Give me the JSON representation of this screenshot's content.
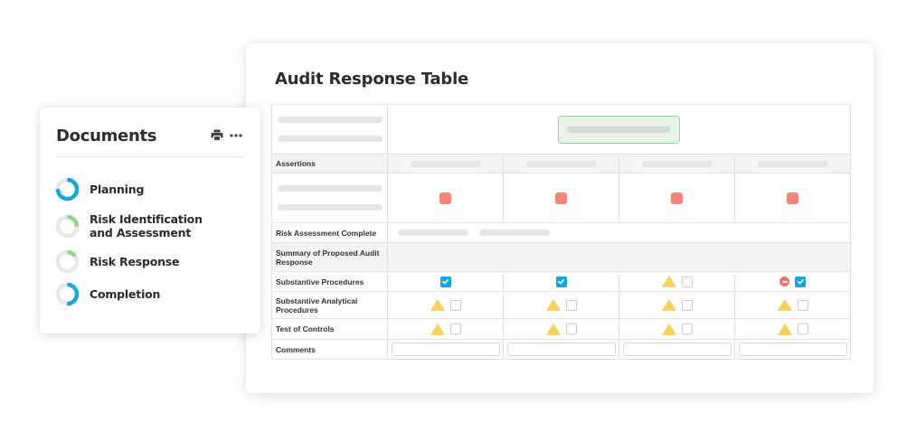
{
  "audit": {
    "title": "Audit Response Table",
    "rows": {
      "assertions": "Assertions",
      "risk_assessment": "Risk Assessment Complete",
      "summary": "Summary of Proposed Audit Response",
      "substantive": "Substantive Procedures",
      "analytical": "Substantive Analytical Procedures",
      "controls": "Test of Controls",
      "comments": "Comments"
    },
    "substantive_status": [
      {
        "icon": "checkbox",
        "checked": true
      },
      {
        "icon": "checkbox",
        "checked": true
      },
      {
        "icon": "warning",
        "checked": false
      },
      {
        "icon": "blocked",
        "checked": true
      }
    ],
    "analytical_status": [
      {
        "icon": "warning",
        "checked": false
      },
      {
        "icon": "warning",
        "checked": false
      },
      {
        "icon": "warning",
        "checked": false
      },
      {
        "icon": "warning",
        "checked": false
      }
    ],
    "controls_status": [
      {
        "icon": "warning",
        "checked": false
      },
      {
        "icon": "warning",
        "checked": false
      },
      {
        "icon": "warning",
        "checked": false
      },
      {
        "icon": "warning",
        "checked": false
      }
    ],
    "colors": {
      "check": "#1ba6d9",
      "warning": "#f7d35c",
      "alert": "#f5837a",
      "accent_green": "#9fd09f"
    }
  },
  "documents": {
    "title": "Documents",
    "items": [
      {
        "label": "Planning",
        "progress": 0.75
      },
      {
        "label": "Risk Identification and Assessment",
        "progress": 0.25
      },
      {
        "label": "Risk Response",
        "progress": 0.15
      },
      {
        "label": "Completion",
        "progress": 0.5
      }
    ],
    "icons": [
      "print-icon",
      "more-icon"
    ]
  }
}
